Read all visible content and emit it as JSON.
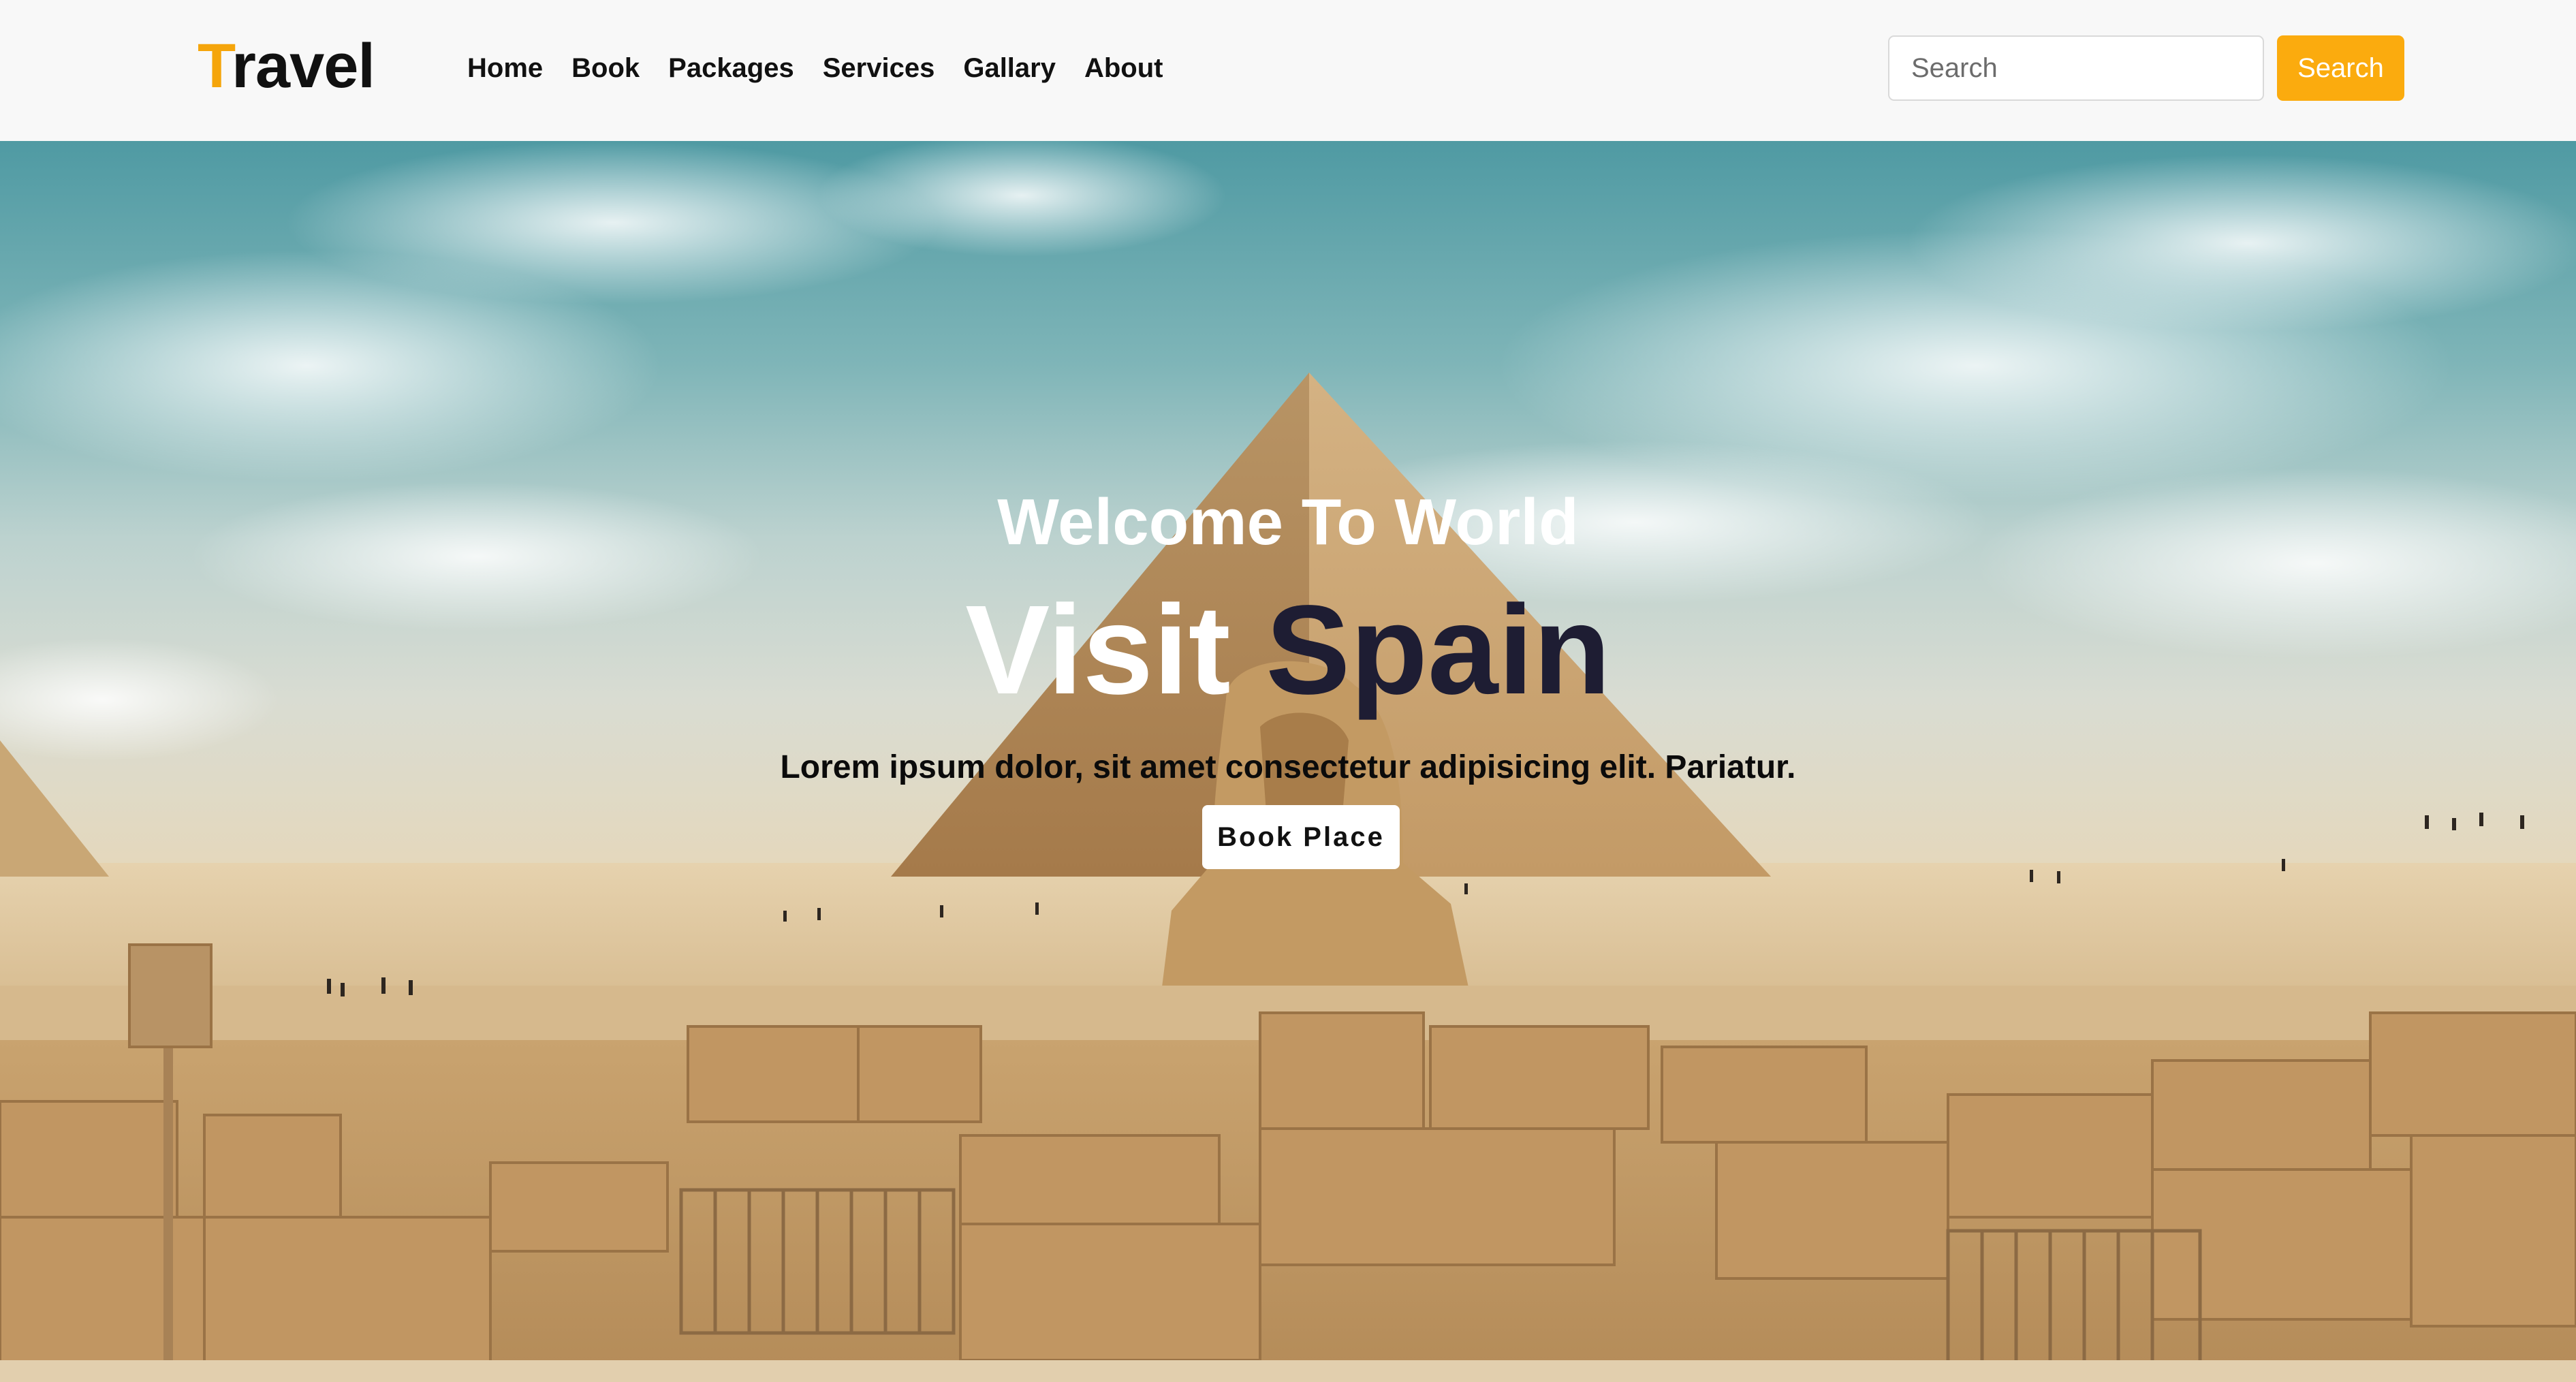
{
  "brand": {
    "first_letter": "T",
    "rest": "ravel"
  },
  "nav": {
    "items": [
      {
        "label": "Home"
      },
      {
        "label": "Book"
      },
      {
        "label": "Packages"
      },
      {
        "label": "Services"
      },
      {
        "label": "Gallary"
      },
      {
        "label": "About"
      }
    ]
  },
  "search": {
    "placeholder": "Search",
    "value": "",
    "button_label": "Search"
  },
  "hero": {
    "welcome": "Welcome To World",
    "headline_word_1": "Visit",
    "headline_word_2": "Spain",
    "lead": "Lorem ipsum dolor, sit amet consectetur adipisicing elit. Pariatur.",
    "cta_label": "Book Place",
    "background_image": "Great Pyramid of Giza with Sphinx and ancient stone ruins under a cloudy blue sky"
  },
  "colors": {
    "accent": "#fbab0e",
    "brand_first_letter": "#f5a50b",
    "navbar_bg": "#f8f8f8",
    "headline_dark": "#1e1d33",
    "text_dark": "#111111",
    "button_text": "#ffffff"
  }
}
